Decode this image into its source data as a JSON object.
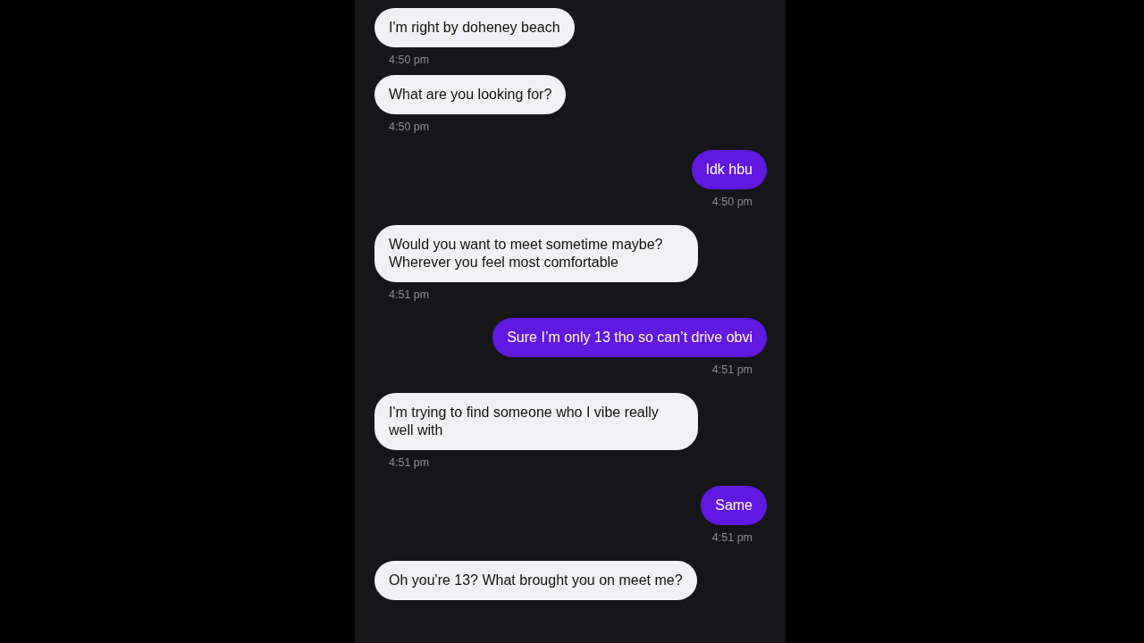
{
  "messages": [
    {
      "kind": "received",
      "text": "I'm right by doheney beach",
      "time": "4:50 pm"
    },
    {
      "kind": "received",
      "text": "What are you looking for?",
      "time": "4:50 pm"
    },
    {
      "kind": "sent",
      "text": "Idk hbu",
      "time": "4:50 pm"
    },
    {
      "kind": "received",
      "text": "Would you want to meet sometime maybe? Wherever you feel most comfortable",
      "time": "4:51 pm"
    },
    {
      "kind": "sent",
      "text": "Sure I’m only 13 tho so can’t drive obvi",
      "time": "4:51 pm"
    },
    {
      "kind": "received",
      "text": "I'm trying to find someone who I vibe really well with",
      "time": "4:51 pm"
    },
    {
      "kind": "sent",
      "text": "Same",
      "time": "4:51 pm"
    },
    {
      "kind": "received",
      "text": "Oh you're 13? What brought you on meet me?"
    }
  ]
}
